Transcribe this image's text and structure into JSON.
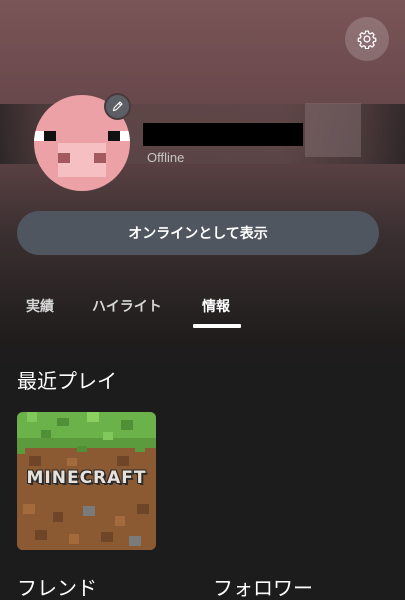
{
  "profile": {
    "status": "Offline",
    "edit_icon": "pencil-icon"
  },
  "header": {
    "settings_icon": "gear-icon"
  },
  "actions": {
    "appear_online_label": "オンラインとして表示"
  },
  "tabs": [
    {
      "label": "実績",
      "active": false
    },
    {
      "label": "ハイライト",
      "active": false
    },
    {
      "label": "情報",
      "active": true
    }
  ],
  "recent": {
    "title": "最近プレイ",
    "games": [
      {
        "logo_text": "MINECRAFT"
      }
    ]
  },
  "social": {
    "friends_label": "フレンド",
    "followers_label": "フォロワー"
  },
  "colors": {
    "avatar_pink": "#eca1a6",
    "button_bg": "#50565f",
    "background": "#1c1c1c"
  }
}
